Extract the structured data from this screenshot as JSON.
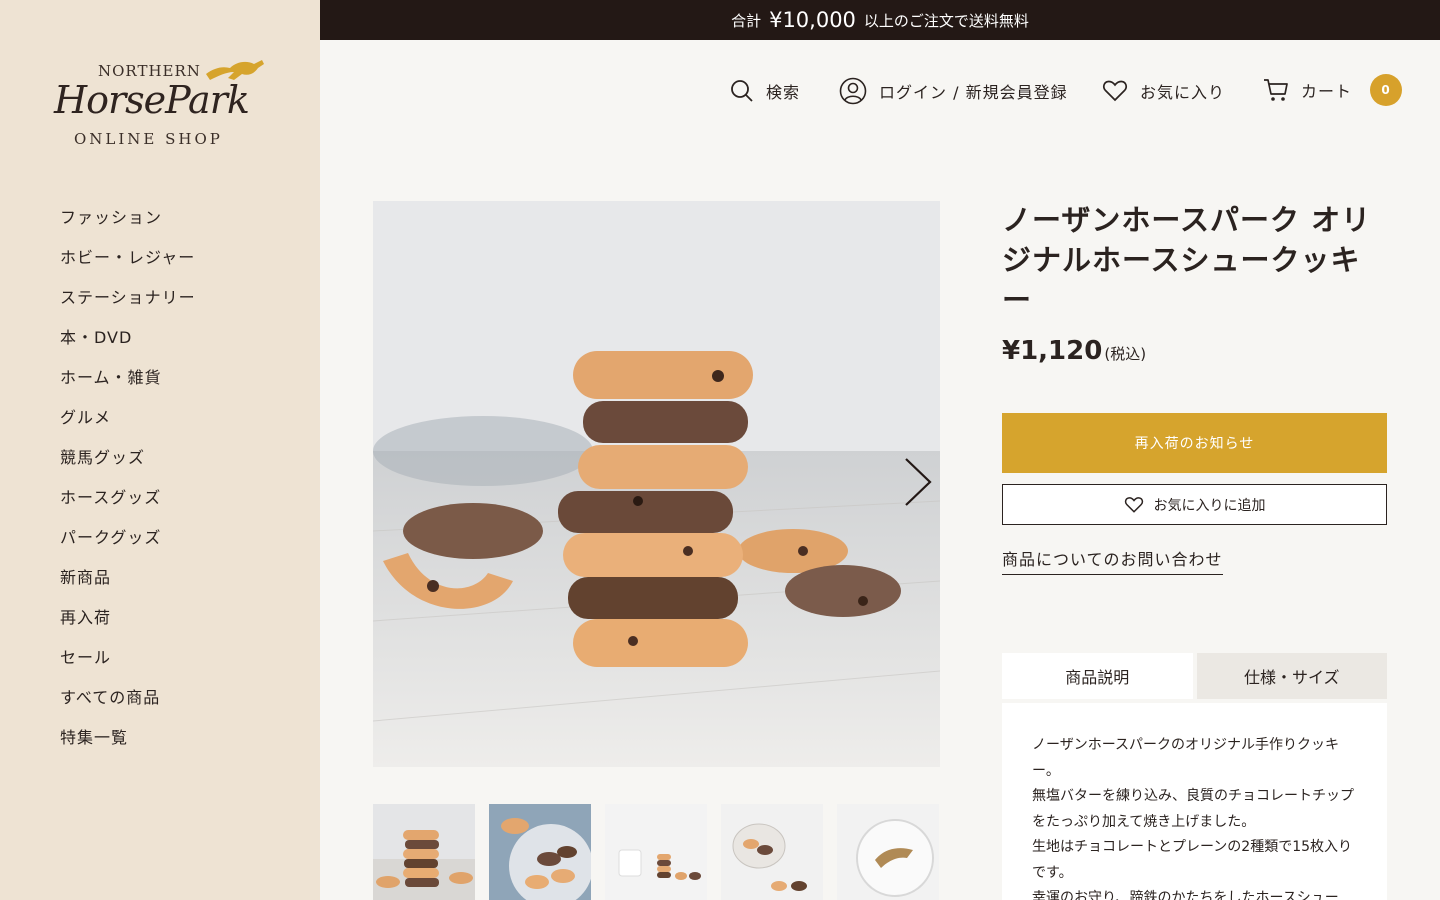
{
  "banner": {
    "prefix": "合計",
    "amount": "¥10,000",
    "suffix": "以上のご注文で送料無料"
  },
  "logo": {
    "line1": "NORTHERN",
    "line2": "HorsePark",
    "line3": "ONLINE SHOP"
  },
  "sidebar": {
    "items": [
      {
        "label": "ファッション"
      },
      {
        "label": "ホビー・レジャー"
      },
      {
        "label": "ステーショナリー"
      },
      {
        "label": "本・DVD"
      },
      {
        "label": "ホーム・雑貨"
      },
      {
        "label": "グルメ"
      },
      {
        "label": "競馬グッズ"
      },
      {
        "label": "ホースグッズ"
      },
      {
        "label": "パークグッズ"
      },
      {
        "label": "新商品"
      },
      {
        "label": "再入荷"
      },
      {
        "label": "セール"
      },
      {
        "label": "すべての商品"
      },
      {
        "label": "特集一覧"
      }
    ]
  },
  "header": {
    "search": "検索",
    "login": "ログイン / 新規会員登録",
    "favorites": "お気に入り",
    "cart": "カート",
    "cart_count": "0"
  },
  "product": {
    "title": "ノーザンホースパーク オリジナルホースシュークッキー",
    "price": "¥1,120",
    "tax_note": "(税込)",
    "restock_button": "再入荷のお知らせ",
    "favorite_button": "お気に入りに追加",
    "inquiry_link": "商品についてのお問い合わせ"
  },
  "tabs": [
    {
      "label": "商品説明",
      "active": true
    },
    {
      "label": "仕様・サイズ",
      "active": false
    }
  ],
  "description": [
    "ノーザンホースパークのオリジナル手作りクッキー。",
    "無塩バターを練り込み、良質のチョコレートチップをたっぷり加えて焼き上げました。",
    "生地はチョコレートとプレーンの2種類で15枚入りです。",
    "幸運のお守り、蹄鉄のかたちをしたホースシュー"
  ],
  "colors": {
    "sidebar_bg": "#eee3d3",
    "banner_bg": "#231815",
    "accent": "#d6a42d",
    "page_bg": "#f7f6f3"
  }
}
